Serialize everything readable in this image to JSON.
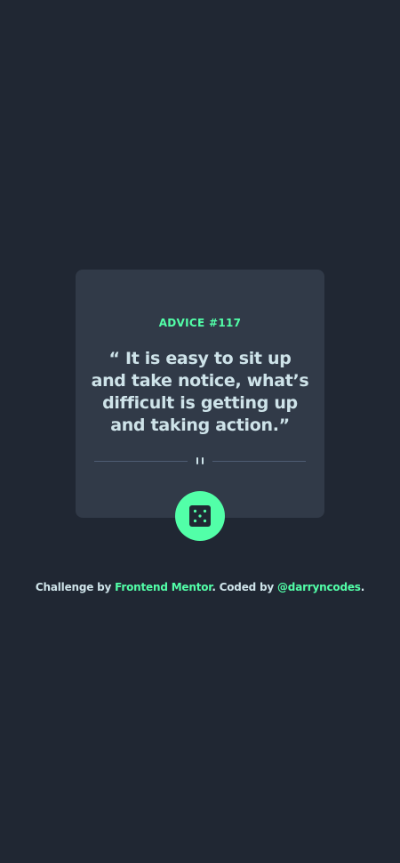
{
  "card": {
    "advice_id": "ADVICE #117",
    "advice_text": "“ It is easy to sit up and take notice, what’s difficult is getting up and taking action.”"
  },
  "dice_button": {
    "icon": "dice-icon"
  },
  "footer": {
    "prefix": "Challenge by ",
    "challenge_link": "Frontend Mentor",
    "middle": ". Coded by ",
    "author_link": "@darryncodes",
    "suffix": "."
  },
  "colors": {
    "background": "#202733",
    "card": "#313a48",
    "accent": "#52ffa8",
    "text": "#cee3e9",
    "divider": "#4f5d74"
  }
}
